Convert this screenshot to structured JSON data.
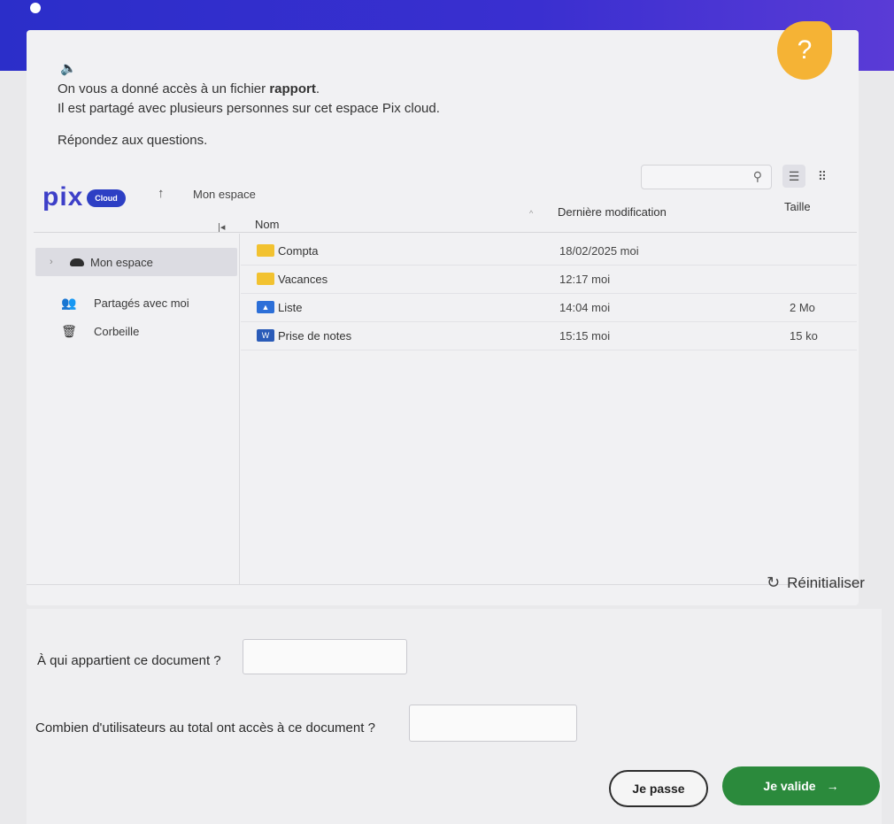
{
  "colors": {
    "topband": "#2b2ec9",
    "help": "#f5b335",
    "folder": "#f2c230",
    "validate": "#2b8a3c"
  },
  "icons": [
    "speaker-icon",
    "help-icon",
    "search-icon",
    "list-view-icon",
    "grid-view-icon",
    "cloud-icon",
    "people-icon",
    "trash-icon",
    "folder-icon",
    "image-file-icon",
    "word-file-icon",
    "refresh-icon",
    "arrow-right-icon"
  ],
  "help": {
    "symbol": "?"
  },
  "instructions": {
    "line1_pre": "On vous a donné accès à un fichier ",
    "line1_bold": "rapport",
    "line1_post": ".",
    "line2": "Il est partagé avec plusieurs personnes sur cet espace Pix cloud.",
    "line3": "Répondez aux questions."
  },
  "app": {
    "logo": "pix",
    "badge": "Cloud",
    "breadcrumb": "Mon espace"
  },
  "table": {
    "headers": {
      "name": "Nom",
      "modified": "Dernière modification",
      "size": "Taille"
    },
    "rows": [
      {
        "name": "Compta",
        "type": "folder",
        "modified": "18/02/2025 moi",
        "size": ""
      },
      {
        "name": "Vacances",
        "type": "folder",
        "modified": "12:17 moi",
        "size": ""
      },
      {
        "name": "Liste",
        "type": "image",
        "modified": "14:04 moi",
        "size": "2 Mo"
      },
      {
        "name": "Prise de notes",
        "type": "word",
        "modified": "15:15 moi",
        "size": "15 ko"
      }
    ]
  },
  "sidebar": {
    "items": [
      {
        "label": "Mon espace",
        "active": true
      },
      {
        "label": "Partagés avec moi",
        "active": false
      },
      {
        "label": "Corbeille",
        "active": false
      }
    ]
  },
  "reset_label": "Réinitialiser",
  "questions": [
    {
      "label": "À qui appartient ce document ?",
      "value": ""
    },
    {
      "label": "Combien d'utilisateurs au total ont accès à ce document ?",
      "value": ""
    }
  ],
  "buttons": {
    "skip": "Je passe",
    "validate": "Je valide"
  }
}
